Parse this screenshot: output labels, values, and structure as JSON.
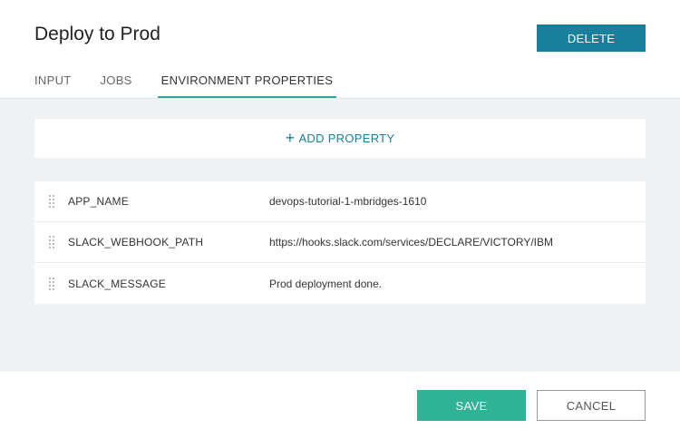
{
  "dialog": {
    "title": "Deploy to Prod",
    "delete_label": "DELETE"
  },
  "tabs": [
    {
      "label": "INPUT",
      "active": false
    },
    {
      "label": "JOBS",
      "active": false
    },
    {
      "label": "ENVIRONMENT PROPERTIES",
      "active": true
    }
  ],
  "add_property": {
    "icon": "plus-icon",
    "plus_glyph": "+",
    "label": "ADD PROPERTY"
  },
  "properties": [
    {
      "name": "APP_NAME",
      "value": "devops-tutorial-1-mbridges-1610"
    },
    {
      "name": "SLACK_WEBHOOK_PATH",
      "value": "https://hooks.slack.com/services/DECLARE/VICTORY/IBM"
    },
    {
      "name": "SLACK_MESSAGE",
      "value": "Prod deployment done."
    }
  ],
  "footer": {
    "save_label": "SAVE",
    "cancel_label": "CANCEL"
  },
  "colors": {
    "accent_blue": "#1a7f9c",
    "accent_green": "#2fb296",
    "tab_underline": "#2fa89a",
    "body_bg": "#eef2f5"
  }
}
